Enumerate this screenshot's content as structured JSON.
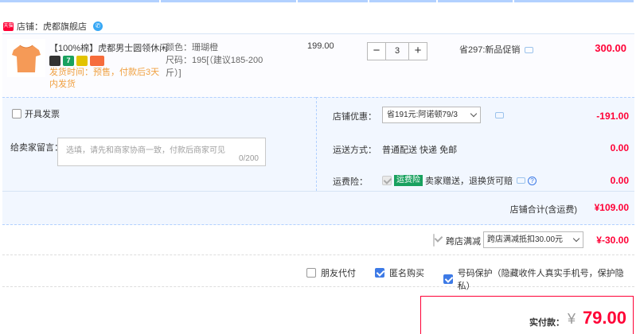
{
  "shop": {
    "badge": "天猫",
    "label": "店铺：虎都旗舰店"
  },
  "item": {
    "title": "【100%棉】虎都男士圆领休闲...",
    "promo_icons": [
      "dark-badge",
      "7-day-return-icon",
      "yellow-badge",
      "orange-badge"
    ],
    "promo_seven": "7",
    "ship_time": "发货时间：预售，付款后3天内发货",
    "color": "颜色：珊瑚橙",
    "size": "尺码：195[（建议185-200斤）]",
    "unit_price": "199.00",
    "qty_minus": "−",
    "qty": "3",
    "qty_plus": "+",
    "promo": "省297:新品促销",
    "line_total": "300.00"
  },
  "options": {
    "invoice_label": "开具发票",
    "message_label": "给卖家留言：",
    "message_placeholder": "选填，请先和商家协商一致，付款后商家可见",
    "message_count": "0/200"
  },
  "right_panel": {
    "shop_discount_label": "店铺优惠：",
    "shop_discount_value": "省191元:阿诺顿79/3",
    "shop_discount_amount": "-191.00",
    "shipping_label": "运送方式：",
    "shipping_value": "普通配送 快递 免邮",
    "shipping_amount": "0.00",
    "insurance_label": "运费险：",
    "insurance_badge": "运费险",
    "insurance_text": "卖家赠送，退换货可赔",
    "insurance_amount": "0.00"
  },
  "subtotal": {
    "label": "店铺合计(含运费)",
    "value": "¥109.00"
  },
  "cross_store": {
    "label": "跨店满减",
    "select_value": "跨店满减抵扣30.00元",
    "amount": "¥-30.00"
  },
  "flags": {
    "friend_pay": "朋友代付",
    "anonymous": "匿名购买",
    "number_protect": "号码保护（隐藏收件人真实手机号，保护隐私）"
  },
  "payment": {
    "label": "实付款：",
    "currency": "¥",
    "amount": "79.00"
  },
  "colors": {
    "accent_red": "#ff0036",
    "panel_blue": "#f2f7ff",
    "border_blue": "#b2d1ff"
  }
}
